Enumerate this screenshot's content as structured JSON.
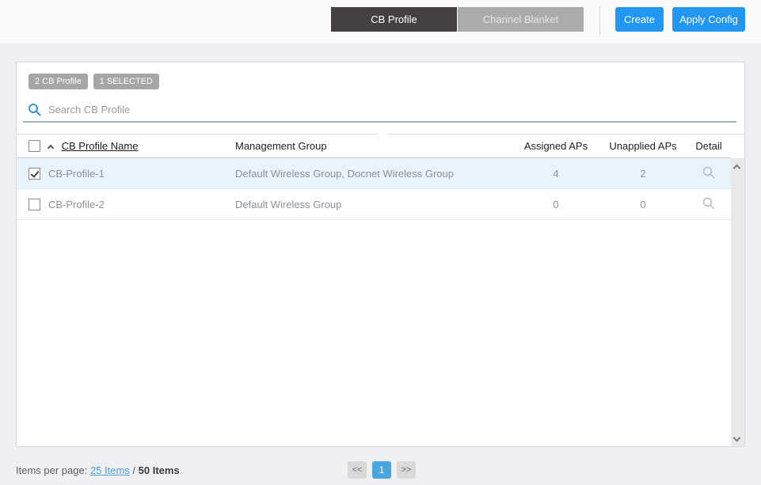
{
  "topbar": {
    "tabs": [
      {
        "label": "CB Profile",
        "active": true
      },
      {
        "label": "Channel Blanket",
        "active": false
      }
    ],
    "buttons": {
      "create": "Create",
      "apply_config": "Apply Config"
    }
  },
  "panel": {
    "badges": [
      "2 CB Profile",
      "1 SELECTED"
    ],
    "search": {
      "placeholder": "Search CB Profile",
      "value": ""
    },
    "table": {
      "headers": {
        "name": "CB Profile Name",
        "management_group": "Management Group",
        "assigned_aps": "Assigned APs",
        "unapplied_aps": "Unapplied APs",
        "detail": "Detail"
      },
      "sort": {
        "column": "CB Profile Name",
        "direction": "ascending"
      },
      "rows": [
        {
          "checked": true,
          "selected": true,
          "name": "CB-Profile-1",
          "management_group": "Default Wireless Group, Docnet Wireless Group",
          "assigned_aps": "4",
          "unapplied_aps": "2"
        },
        {
          "checked": false,
          "selected": false,
          "name": "CB-Profile-2",
          "management_group": "Default Wireless Group",
          "assigned_aps": "0",
          "unapplied_aps": "0"
        }
      ]
    }
  },
  "footer": {
    "items_per_page_label": "Items per page:",
    "page_size_link": "25 Items",
    "separator": " / ",
    "total_label": "50 Items",
    "pagination": {
      "first": "<<",
      "current_page": "1",
      "last": ">>"
    }
  },
  "colors": {
    "accent_blue": "#2196f3",
    "pagination_active_blue": "#4aa6de",
    "tab_active_bg": "#454140",
    "tab_inactive_bg": "#ababab",
    "selected_row_bg": "#e9f3fc",
    "badge_bg": "#a6a6a6",
    "search_icon_blue": "#3d8fd6",
    "search_underline": "#9fb4c5"
  }
}
